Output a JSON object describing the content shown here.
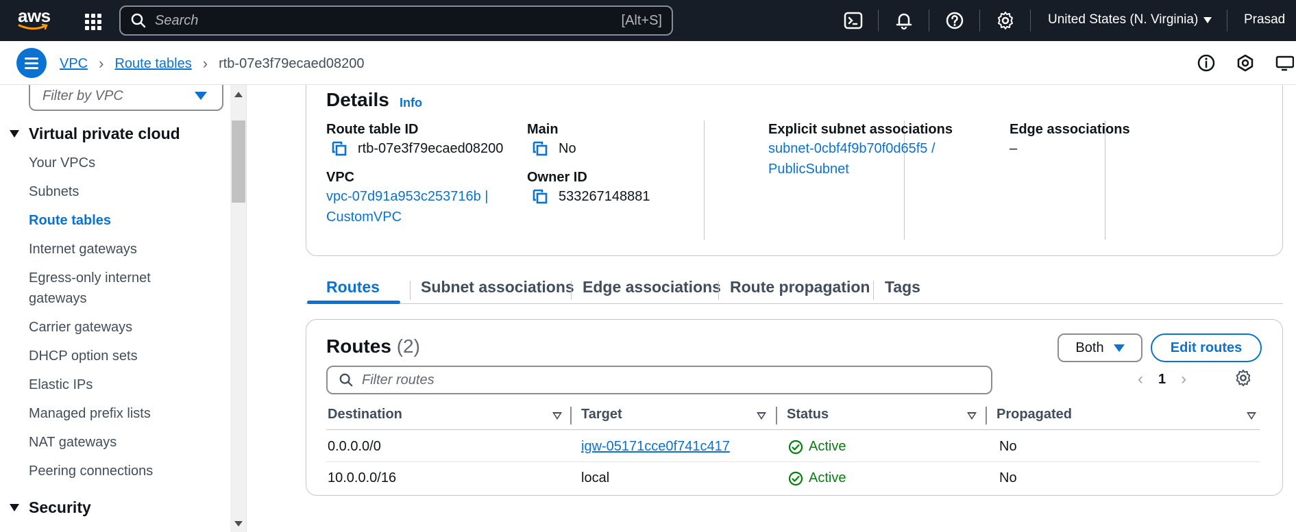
{
  "topbar": {
    "logo_text": "aws",
    "search_placeholder": "Search",
    "search_shortcut": "[Alt+S]",
    "region": "United States (N. Virginia)",
    "user": "Prasad",
    "icons": [
      "cloudshell-icon",
      "bell-icon",
      "help-icon",
      "gear-icon"
    ]
  },
  "breadcrumb": {
    "items": [
      "VPC",
      "Route tables"
    ],
    "current": "rtb-07e3f79ecaed08200"
  },
  "sidebar": {
    "filter_placeholder": "Filter by VPC",
    "section_vpc": "Virtual private cloud",
    "items": [
      {
        "label": "Your VPCs"
      },
      {
        "label": "Subnets"
      },
      {
        "label": "Route tables",
        "active": true
      },
      {
        "label": "Internet gateways"
      },
      {
        "label": "Egress-only internet gateways"
      },
      {
        "label": "Carrier gateways"
      },
      {
        "label": "DHCP option sets"
      },
      {
        "label": "Elastic IPs"
      },
      {
        "label": "Managed prefix lists"
      },
      {
        "label": "NAT gateways"
      },
      {
        "label": "Peering connections"
      }
    ],
    "section_security": "Security"
  },
  "details": {
    "title": "Details",
    "info": "Info",
    "route_table_id_label": "Route table ID",
    "route_table_id": "rtb-07e3f79ecaed08200",
    "vpc_label": "VPC",
    "vpc_value": "vpc-07d91a953c253716b | CustomVPC",
    "main_label": "Main",
    "main_value": "No",
    "owner_label": "Owner ID",
    "owner_value": "533267148881",
    "explicit_label": "Explicit subnet associations",
    "explicit_value": "subnet-0cbf4f9b70f0d65f5 / PublicSubnet",
    "edge_label": "Edge associations",
    "edge_value": "–"
  },
  "tabs": [
    "Routes",
    "Subnet associations",
    "Edge associations",
    "Route propagation",
    "Tags"
  ],
  "routes": {
    "title": "Routes",
    "count": "(2)",
    "filter_select": "Both",
    "edit_button": "Edit routes",
    "filter_placeholder": "Filter routes",
    "page": "1",
    "columns": [
      "Destination",
      "Target",
      "Status",
      "Propagated"
    ],
    "rows": [
      {
        "destination": "0.0.0.0/0",
        "target": "igw-05171cce0f741c417",
        "status": "Active",
        "propagated": "No"
      },
      {
        "destination": "10.0.0.0/16",
        "target": "local",
        "status": "Active",
        "propagated": "No"
      }
    ]
  },
  "colors": {
    "accent": "#0972d3",
    "success": "#037f0c",
    "header_bg": "#161d26"
  }
}
